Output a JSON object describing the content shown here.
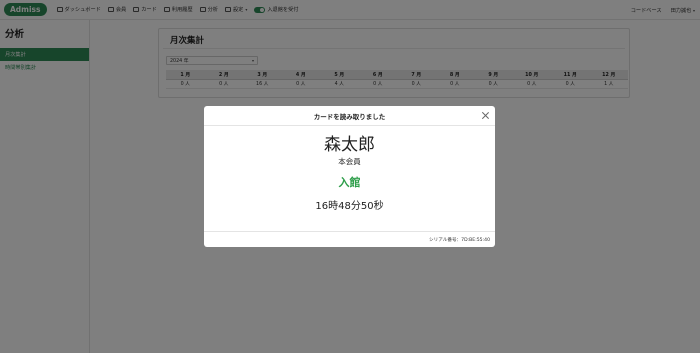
{
  "app": {
    "brand": "Admiss"
  },
  "nav": {
    "items": [
      {
        "label": "ダッシュボード",
        "icon": "dashboard-icon"
      },
      {
        "label": "会員",
        "icon": "users-icon"
      },
      {
        "label": "カード",
        "icon": "card-icon"
      },
      {
        "label": "利用履歴",
        "icon": "history-icon"
      },
      {
        "label": "分析",
        "icon": "chart-icon"
      },
      {
        "label": "設定",
        "icon": "gear-icon"
      }
    ],
    "checkin_toggle_label": "入退館を受付",
    "right": {
      "code_base": "コードベース",
      "user": "田力誠也"
    }
  },
  "sidebar": {
    "title": "分析",
    "items": [
      {
        "label": "月次集計",
        "active": true
      },
      {
        "label": "時間帯別集計",
        "active": false
      }
    ]
  },
  "main": {
    "title": "月次集計",
    "year_select": "2024 年",
    "months": [
      "1 月",
      "2 月",
      "3 月",
      "4 月",
      "5 月",
      "6 月",
      "7 月",
      "8 月",
      "9 月",
      "10 月",
      "11 月",
      "12 月"
    ],
    "counts": [
      "0 人",
      "0 人",
      "16 人",
      "0 人",
      "4 人",
      "0 人",
      "0 人",
      "0 人",
      "0 人",
      "0 人",
      "0 人",
      "1 人"
    ]
  },
  "modal": {
    "title": "カードを読み取りました",
    "member_name": "森太郎",
    "member_type": "本会員",
    "status": "入館",
    "status_color": "#2e9e4a",
    "time": "16時48分50秒",
    "serial": "シリアル番号：7D:BE:55:40"
  },
  "colors": {
    "accent": "#2e8b57"
  }
}
